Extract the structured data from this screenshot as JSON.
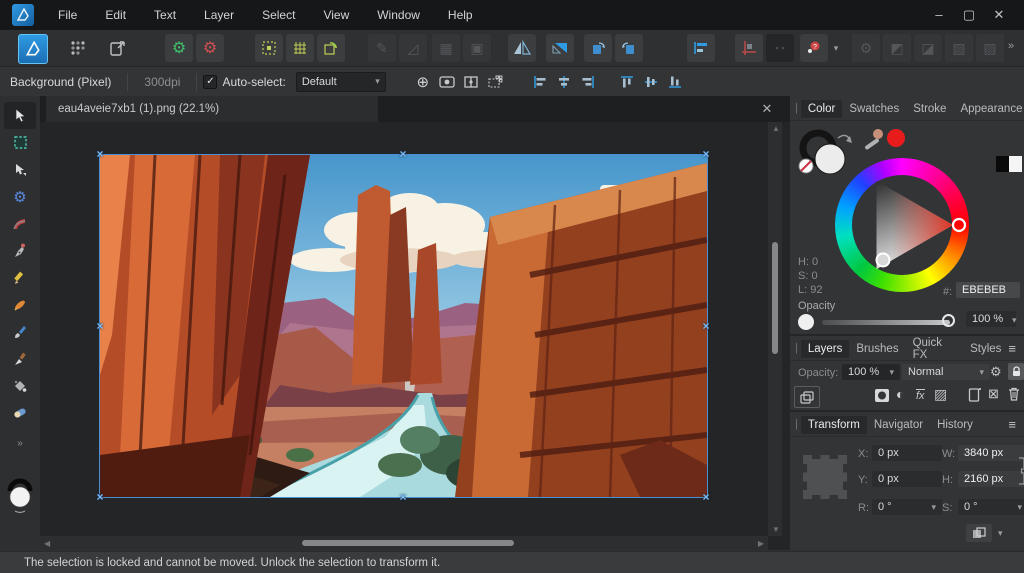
{
  "titlebar": {
    "menus": [
      "File",
      "Edit",
      "Text",
      "Layer",
      "Select",
      "View",
      "Window",
      "Help"
    ]
  },
  "toolbar": {
    "overflow": "»"
  },
  "context_toolbar": {
    "layer_label": "Background (Pixel)",
    "dpi": "300dpi",
    "autoselect_label": "Auto-select:",
    "autoselect_value": "Default"
  },
  "document_tab": {
    "title": "eau4aveie7xb1 (1).png (22.1%)"
  },
  "color_panel": {
    "tabs": [
      "Color",
      "Swatches",
      "Stroke",
      "Appearance"
    ],
    "active_tab": "Color",
    "hsl": {
      "h": "H: 0",
      "s": "S: 0",
      "l": "L: 92"
    },
    "hex_label": "#:",
    "hex_value": "EBEBEB",
    "opacity_label": "Opacity",
    "opacity_value": "100 %"
  },
  "layers_panel": {
    "tabs": [
      "Layers",
      "Brushes",
      "Quick FX",
      "Styles"
    ],
    "active_tab": "Layers",
    "opacity_label": "Opacity:",
    "opacity_value": "100 %",
    "blend_mode": "Normal"
  },
  "transform_panel": {
    "tabs": [
      "Transform",
      "Navigator",
      "History"
    ],
    "active_tab": "Transform",
    "x_label": "X:",
    "x_value": "0 px",
    "y_label": "Y:",
    "y_value": "0 px",
    "w_label": "W:",
    "w_value": "3840 px",
    "h_label": "H:",
    "h_value": "2160 px",
    "r_label": "R:",
    "r_value": "0 °",
    "s_label": "S:",
    "s_value": "0 °"
  },
  "status_bar": {
    "message": "The selection is locked and cannot be moved. Unlock the selection to transform it."
  },
  "colors": {
    "accent": "#2F9BE4",
    "current_hex": "#EBEBEB",
    "selection_handle": "#7DB9F2"
  }
}
